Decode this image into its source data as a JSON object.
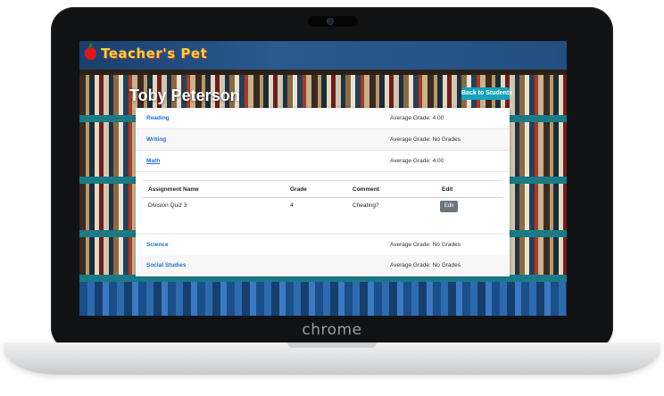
{
  "brand": {
    "logo_text": "Teacher's Pet",
    "laptop_label": "chrome"
  },
  "header": {
    "student_name": "Toby Peterson",
    "back_label": "Back to Students"
  },
  "subjects": [
    {
      "name": "Reading",
      "avg": "Average Grade: 4.00"
    },
    {
      "name": "Writing",
      "avg": "Average Grade: No Grades"
    },
    {
      "name": "Math",
      "avg": "Average Grade: 4.00"
    },
    {
      "name": "Science",
      "avg": "Average Grade: No Grades"
    },
    {
      "name": "Social Studies",
      "avg": "Average Grade: No Grades"
    }
  ],
  "assignments": {
    "headers": [
      "Assignment Name",
      "Grade",
      "Comment",
      "Edit"
    ],
    "rows": [
      {
        "name": "Division Quiz 3",
        "grade": "4",
        "comment": "Cheating?",
        "edit_label": "Edit"
      }
    ]
  },
  "colors": {
    "accent": "#17a2b8",
    "link": "#1f6fd0",
    "edit_button": "#6c757d"
  }
}
